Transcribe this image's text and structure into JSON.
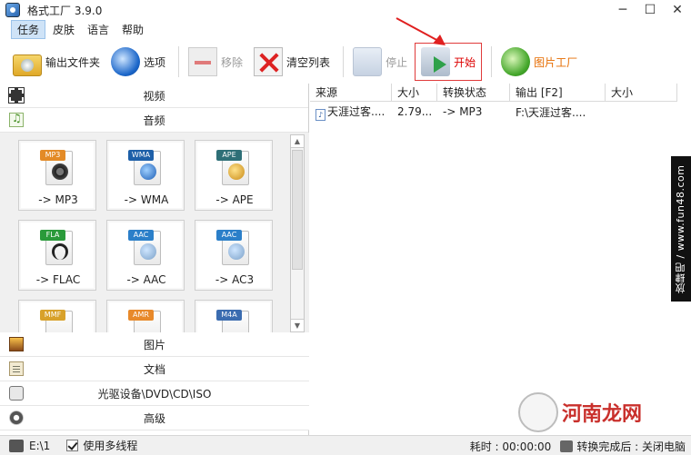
{
  "window": {
    "title": "格式工厂 3.9.0",
    "controls": {
      "minimize": "─",
      "maximize": "☐",
      "close": "✕"
    }
  },
  "menu": {
    "items": [
      "任务",
      "皮肤",
      "语言",
      "帮助"
    ],
    "active_index": 0
  },
  "toolbar": {
    "output_folder": "输出文件夹",
    "options": "选项",
    "remove": "移除",
    "clear_list": "清空列表",
    "stop": "停止",
    "start": "开始",
    "picture_factory": "图片工厂"
  },
  "categories": {
    "video": "视频",
    "audio": "音频",
    "picture": "图片",
    "document": "文档",
    "rom": "光驱设备\\DVD\\CD\\ISO",
    "advanced": "高级"
  },
  "formats": [
    {
      "label": "-> MP3",
      "tag": "MP3"
    },
    {
      "label": "-> WMA",
      "tag": "WMA"
    },
    {
      "label": "-> APE",
      "tag": "APE"
    },
    {
      "label": "-> FLAC",
      "tag": "FLA"
    },
    {
      "label": "-> AAC",
      "tag": "AAC"
    },
    {
      "label": "-> AC3",
      "tag": "AAC"
    },
    {
      "label": "",
      "tag": "MMF"
    },
    {
      "label": "",
      "tag": "AMR"
    },
    {
      "label": "",
      "tag": "M4A"
    }
  ],
  "table": {
    "headers": [
      "来源",
      "大小",
      "转换状态",
      "输出 [F2]",
      "大小"
    ],
    "rows": [
      {
        "source": "天涯过客....",
        "size": "2.79...",
        "status": "-> MP3",
        "output": "F:\\天涯过客....",
        "out_size": ""
      }
    ]
  },
  "watermark": {
    "side_text": "放肆吧 / www.fun48.com",
    "brand": "河南龙网"
  },
  "status": {
    "path": "E:\\1",
    "multithread": "使用多线程",
    "elapsed": "耗时 : 00:00:00",
    "after_done": "转换完成后 : 关闭电脑"
  }
}
